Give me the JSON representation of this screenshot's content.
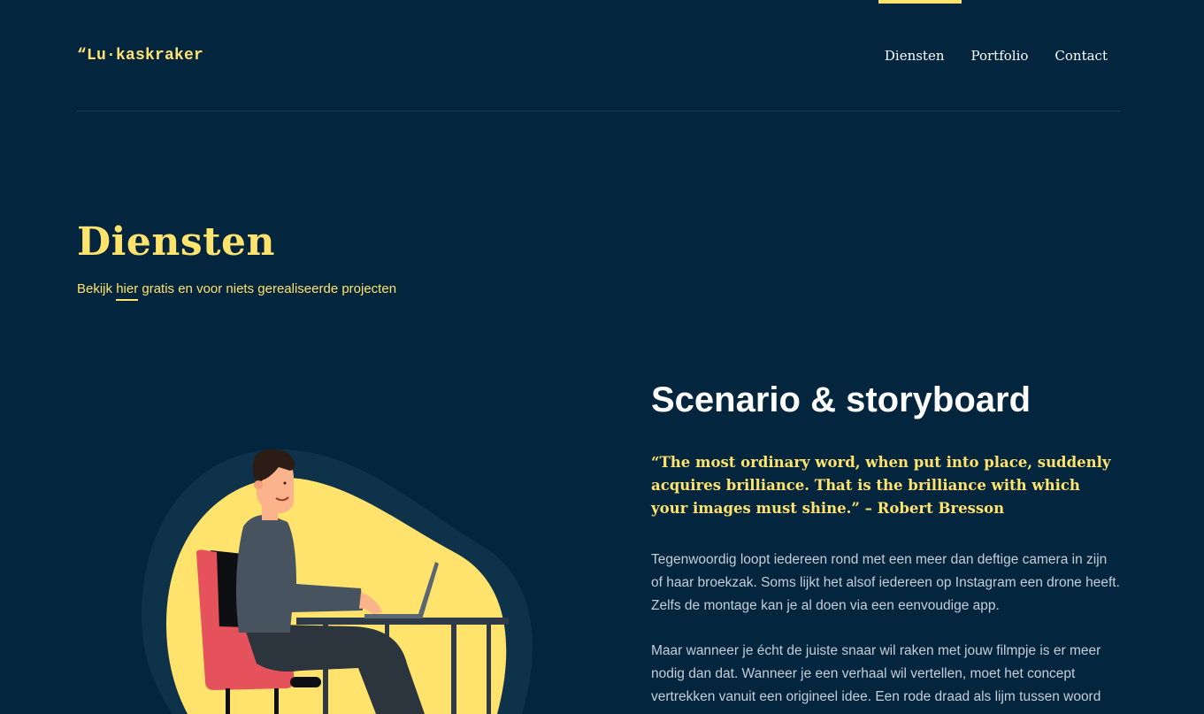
{
  "header": {
    "logo": "“Lu·kaskraker",
    "nav": [
      {
        "label": "Diensten"
      },
      {
        "label": "Portfolio"
      },
      {
        "label": "Contact"
      }
    ]
  },
  "hero": {
    "title": "Diensten",
    "subtitle_before": "Bekijk ",
    "subtitle_link": "hier",
    "subtitle_after": " gratis en voor niets gerealiseerde projecten"
  },
  "service": {
    "title": "Scenario & storyboard",
    "quote": "“The most ordinary word, when put into place, suddenly acquires brilliance. That is the brilliance with which your images must shine.” – Robert Bresson",
    "paragraphs": [
      "Tegenwoordig loopt iedereen rond met een meer dan deftige camera in zijn of haar broekzak. Soms lijkt het alsof iedereen op Instagram een drone heeft. Zelfs de montage kan je al doen via een eenvoudige app.",
      "Maar wanneer je écht de juiste snaar wil raken met jouw filmpje is er meer nodig dan dat. Wanneer je een verhaal wil vertellen, moet het concept vertrekken vanuit een origineel idee. Een rode draad als lijm tussen woord"
    ]
  },
  "colors": {
    "background": "#03253e",
    "accent": "#ffe36d",
    "text": "#ffffff",
    "body_text": "#c6ced8"
  },
  "icons": {
    "illustration": "person-at-laptop-illustration"
  }
}
